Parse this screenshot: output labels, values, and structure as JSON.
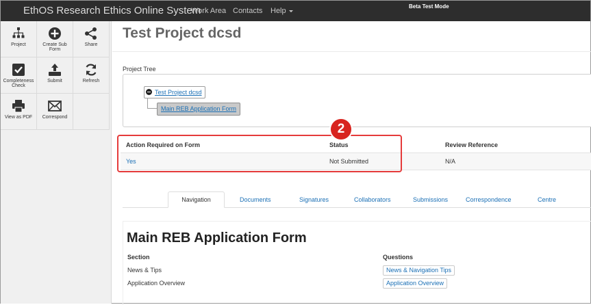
{
  "navbar": {
    "brand": "EthOS Research Ethics Online System",
    "links": [
      "Work Area",
      "Contacts",
      "Help"
    ],
    "mode": "Beta Test Mode"
  },
  "toolbar": {
    "items": [
      {
        "label": "Project",
        "icon": "hierarchy-icon"
      },
      {
        "label": "Create Sub Form",
        "icon": "plus-circle-icon"
      },
      {
        "label": "Share",
        "icon": "share-icon"
      },
      {
        "label": "Completeness Check",
        "icon": "checkbox-icon"
      },
      {
        "label": "Submit",
        "icon": "upload-icon"
      },
      {
        "label": "Refresh",
        "icon": "refresh-icon"
      },
      {
        "label": "View as PDF",
        "icon": "printer-icon"
      },
      {
        "label": "Correspond",
        "icon": "envelope-icon"
      }
    ]
  },
  "page": {
    "title": "Test Project dcsd",
    "tree_label": "Project Tree",
    "tree": {
      "root": "Test Project dcsd",
      "child": "Main REB Application Form"
    }
  },
  "action_table": {
    "headers": [
      "Action Required on Form",
      "Status",
      "Review Reference"
    ],
    "row": [
      "Yes",
      "Not Submitted",
      "N/A"
    ]
  },
  "callout": {
    "number": "2",
    "color": "#d8241f"
  },
  "tabs": [
    "Navigation",
    "Documents",
    "Signatures",
    "Collaborators",
    "Submissions",
    "Correspondence",
    "Centre"
  ],
  "active_tab": "Navigation",
  "form": {
    "title": "Main REB Application Form",
    "headers": [
      "Section",
      "Questions"
    ],
    "sections": [
      "News & Tips",
      "Application Overview"
    ],
    "questions": [
      "News & Navigation Tips",
      "Application Overview"
    ]
  },
  "colors": {
    "link": "#1a6fb5",
    "highlight": "#e53a3a",
    "navbar": "#2d2d2d"
  }
}
